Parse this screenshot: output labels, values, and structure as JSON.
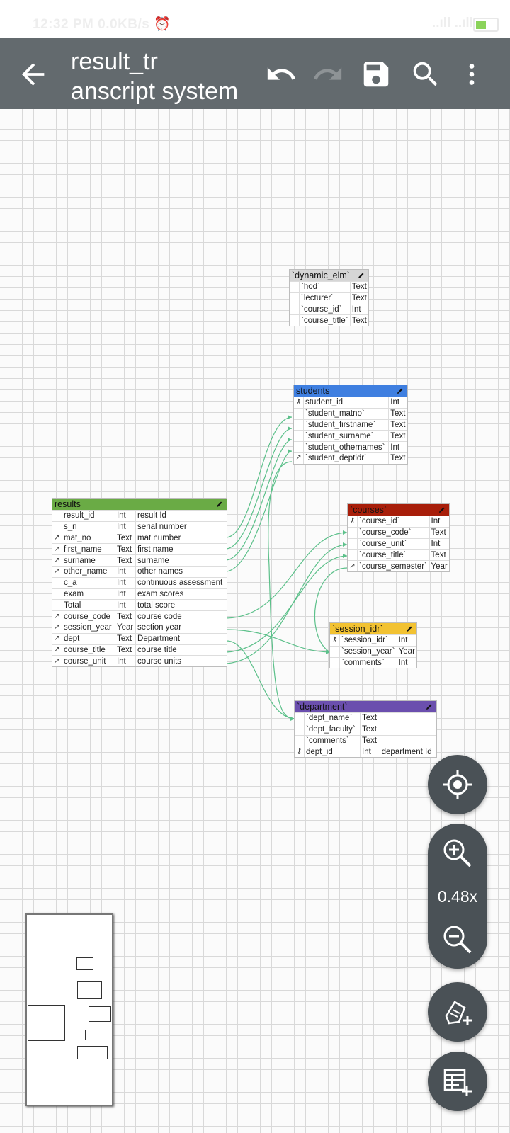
{
  "status": {
    "time": "12:32 PM 0.0KB/s ⏰",
    "signal": "..ıll ..ıll",
    "battery": "49"
  },
  "appbar": {
    "title": "result_tr\nanscript system"
  },
  "icons": {
    "back": "arrow-left-icon",
    "undo": "undo-icon",
    "redo": "redo-icon",
    "save": "save-icon",
    "search": "search-icon",
    "more": "more-vert-icon"
  },
  "tables": {
    "dynamic_elm": {
      "name": "`dynamic_elm`",
      "color": "#d6d6d6",
      "rows": [
        [
          "",
          "`hod`",
          "Text"
        ],
        [
          "",
          "`lecturer`",
          "Text"
        ],
        [
          "",
          "`course_id`",
          "Int"
        ],
        [
          "",
          "`course_title`",
          "Text"
        ]
      ]
    },
    "students": {
      "name": "students",
      "color": "#3f7fe0",
      "rows": [
        [
          "pk",
          "student_id",
          "Int"
        ],
        [
          "",
          "`student_matno`",
          "Text"
        ],
        [
          "",
          "`student_firstname`",
          "Text"
        ],
        [
          "",
          "`student_surname`",
          "Text"
        ],
        [
          "",
          "`student_othernames`",
          "Int"
        ],
        [
          "fk",
          "`student_deptidr`",
          "Text"
        ]
      ]
    },
    "results": {
      "name": "results",
      "color": "#6aab45",
      "rows": [
        [
          "",
          "result_id",
          "Int",
          "result Id"
        ],
        [
          "",
          "s_n",
          "Int",
          "serial number"
        ],
        [
          "fk",
          "mat_no",
          "Text",
          "mat number"
        ],
        [
          "fk",
          "first_name",
          "Text",
          "first name"
        ],
        [
          "fk",
          "surname",
          "Text",
          "surname"
        ],
        [
          "fk",
          "other_name",
          "Int",
          "other names"
        ],
        [
          "",
          "c_a",
          "Int",
          "continuous assessment"
        ],
        [
          "",
          "exam",
          "Int",
          "exam scores"
        ],
        [
          "",
          "Total",
          "Int",
          "total score"
        ],
        [
          "fk",
          "course_code",
          "Text",
          "course code"
        ],
        [
          "fk",
          "session_year",
          "Year",
          "section year"
        ],
        [
          "fk",
          "dept",
          "Text",
          "Department"
        ],
        [
          "fk",
          "course_title",
          "Text",
          "course title"
        ],
        [
          "fk",
          "course_unit",
          "Int",
          "course units"
        ]
      ]
    },
    "courses": {
      "name": "`courses`",
      "color": "#a81e0a",
      "rows": [
        [
          "pk",
          "`course_id`",
          "Int"
        ],
        [
          "",
          "`course_code`",
          "Text"
        ],
        [
          "",
          "`course_unit`",
          "Int"
        ],
        [
          "",
          "`course_title`",
          "Text"
        ],
        [
          "fk",
          "`course_semester`",
          "Year"
        ]
      ]
    },
    "session_idr": {
      "name": "`session_idr`",
      "color": "#f2c232",
      "rows": [
        [
          "pk",
          "`session_idr`",
          "Int"
        ],
        [
          "",
          "`session_year`",
          "Year"
        ],
        [
          "",
          "`comments`",
          "Int"
        ]
      ]
    },
    "department": {
      "name": "`department`",
      "color": "#6b4fae",
      "rows": [
        [
          "",
          "`dept_name`",
          "Text",
          ""
        ],
        [
          "",
          "`dept_faculty`",
          "Text",
          ""
        ],
        [
          "",
          "`comments`",
          "Text",
          ""
        ],
        [
          "pk",
          "dept_id",
          "Int",
          "department Id"
        ]
      ]
    }
  },
  "zoom": {
    "level": "0.48x"
  },
  "fabs": {
    "locate": "crosshair-icon",
    "zoom_in": "zoom-in-icon",
    "zoom_out": "zoom-out-icon",
    "add_note": "add-note-icon",
    "add_table": "add-table-icon"
  },
  "colors": {
    "appbar": "#636a6e",
    "link": "#5cc08a",
    "fab": "#4a5156"
  }
}
